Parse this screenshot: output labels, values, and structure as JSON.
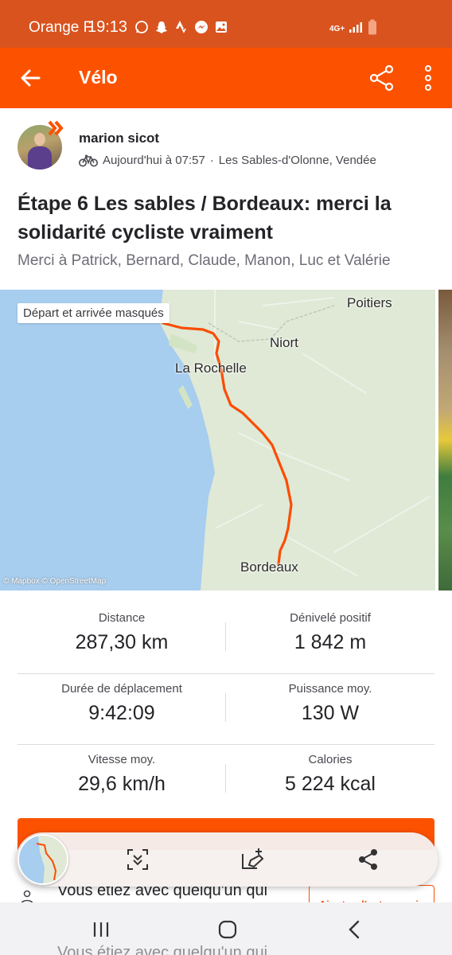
{
  "status_bar": {
    "carrier": "Orange F",
    "time": "19:13",
    "network": "4G+"
  },
  "app_bar": {
    "title": "Vélo"
  },
  "activity": {
    "athlete_name": "marion sicot",
    "timestamp": "Aujourd'hui à 07:57",
    "location": "Les Sables-d'Olonne, Vendée",
    "title": "Étape 6 Les sables / Bordeaux: merci la solidarité cycliste vraiment",
    "description": "Merci à Patrick, Bernard, Claude, Manon, Luc et Valérie"
  },
  "map": {
    "privacy_label": "Départ et arrivée masqués",
    "attribution": "© Mapbox © OpenStreetMap",
    "places": {
      "poitiers": "Poitiers",
      "niort": "Niort",
      "la_rochelle": "La Rochelle",
      "bordeaux": "Bordeaux"
    },
    "route_color": "#fc4c02",
    "water_color": "#a7cdef",
    "land_color": "#dfe9d6"
  },
  "stats": [
    {
      "left_label": "Distance",
      "left_value": "287,30 km",
      "right_label": "Dénivelé positif",
      "right_value": "1 842 m"
    },
    {
      "left_label": "Durée de déplacement",
      "left_value": "9:42:09",
      "right_label": "Puissance moy.",
      "right_value": "130 W"
    },
    {
      "left_label": "Vitesse moy.",
      "left_value": "29,6 km/h",
      "right_label": "Calories",
      "right_value": "5 224 kcal"
    }
  ],
  "partial_content": {
    "together_text": "Vous étiez avec quelqu'un qui",
    "add_others_button": "Ajouter d'autres amis",
    "ghost_text": "Vous étiez avec quelqu'un qui"
  },
  "colors": {
    "brand": "#fc5200",
    "status_bar": "#d9531e"
  }
}
